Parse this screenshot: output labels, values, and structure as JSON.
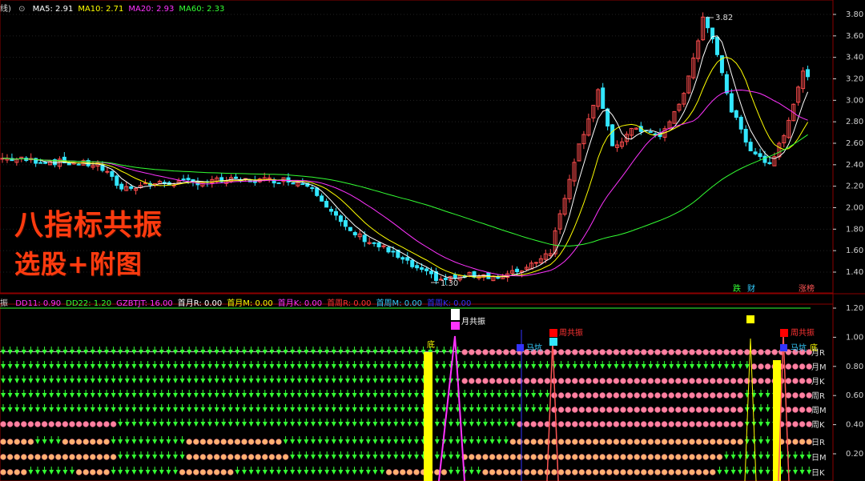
{
  "header": {
    "prefix": "线)",
    "ma_items": [
      {
        "label": "MA5: 2.91",
        "color": "#ffffff"
      },
      {
        "label": "MA10: 2.71",
        "color": "#ffff00"
      },
      {
        "label": "MA20: 2.93",
        "color": "#ff33ff"
      },
      {
        "label": "MA60: 2.33",
        "color": "#33ff33"
      }
    ]
  },
  "promo": {
    "line1": "八指标共振",
    "line2": "选股+附图"
  },
  "sub_header": {
    "prefix": "振",
    "items": [
      {
        "label": "DD11: 0.90",
        "color": "#ff33ff"
      },
      {
        "label": "DD22: 1.20",
        "color": "#33ff33"
      },
      {
        "label": "GZBTJT: 16.00",
        "color": "#ff33ff"
      },
      {
        "label": "首月R: 0.00",
        "color": "#ffffff"
      },
      {
        "label": "首月M: 0.00",
        "color": "#ffff00"
      },
      {
        "label": "首月K: 0.00",
        "color": "#ff33ff"
      },
      {
        "label": "首周R: 0.00",
        "color": "#ff3333"
      },
      {
        "label": "首周M: 0.00",
        "color": "#33ccff"
      },
      {
        "label": "首周K: 0.00",
        "color": "#3333ff"
      }
    ]
  },
  "annotations": {
    "high_label": "3.82",
    "low_label": "1.30",
    "badges": [
      {
        "text": "跌",
        "color": "#33ff33"
      },
      {
        "text": "财",
        "color": "#33ccff"
      },
      {
        "text": "涨榜",
        "color": "#ff5555"
      }
    ],
    "sub_labels": [
      {
        "text": "底",
        "color": "#ffff00"
      },
      {
        "text": "月共振",
        "color": "#ffffff"
      },
      {
        "text": "马坑",
        "color": "#33ccff"
      },
      {
        "text": "周共振",
        "color": "#ff3333"
      },
      {
        "text": "马坑",
        "color": "#33ccff"
      },
      {
        "text": "周共振",
        "color": "#ff3333"
      },
      {
        "text": "底",
        "color": "#ffff00"
      }
    ],
    "row_labels": [
      "月R",
      "月M",
      "月K",
      "周R",
      "周M",
      "周K",
      "日R",
      "日M",
      "日K"
    ]
  },
  "colors": {
    "up": "#ff4d4d",
    "down": "#33e6ff",
    "ma5": "#ffffff",
    "ma10": "#ffff00",
    "ma20": "#ff33ff",
    "ma60": "#33ff33",
    "grid": "#8b0000",
    "arrow": "#33ff33",
    "dot": "#ff80a0",
    "dot_orange": "#ffb070"
  },
  "chart_data": [
    {
      "type": "candlestick",
      "title": "",
      "ylim": [
        1.25,
        3.95
      ],
      "y_ticks": [
        "3.80",
        "3.60",
        "3.40",
        "3.20",
        "3.00",
        "2.80",
        "2.60",
        "2.40",
        "2.20",
        "2.00",
        "1.80",
        "1.60",
        "1.40"
      ],
      "grid": true,
      "high": 3.82,
      "low": 1.3,
      "series": [
        {
          "name": "MA5",
          "last": 2.91
        },
        {
          "name": "MA10",
          "last": 2.71
        },
        {
          "name": "MA20",
          "last": 2.93
        },
        {
          "name": "MA60",
          "last": 2.33
        }
      ]
    },
    {
      "type": "bar",
      "title": "",
      "ylim": [
        0,
        1.3
      ],
      "y_ticks": [
        "1.20",
        "1.00",
        "0.80",
        "0.60",
        "0.40",
        "0.20"
      ],
      "grid": true,
      "series": [
        {
          "name": "DD11",
          "last": 0.9
        },
        {
          "name": "DD22",
          "last": 1.2
        },
        {
          "name": "GZBTJT",
          "last": 16.0
        }
      ]
    }
  ]
}
